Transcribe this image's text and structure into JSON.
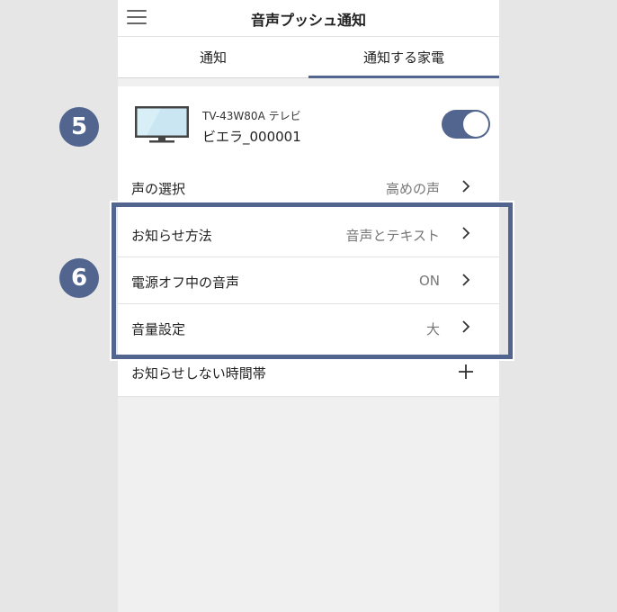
{
  "header": {
    "title": "音声プッシュ通知",
    "menu_icon": "hamburger-menu-icon"
  },
  "tabs": [
    {
      "label": "通知",
      "active": false
    },
    {
      "label": "通知する家電",
      "active": true
    }
  ],
  "device": {
    "model": "TV-43W80A テレビ",
    "name": "ビエラ_000001",
    "icon": "tv-icon",
    "enabled": true
  },
  "settings": [
    {
      "label": "声の選択",
      "value": "高めの声"
    },
    {
      "label": "お知らせ方法",
      "value": "音声とテキスト"
    },
    {
      "label": "電源オフ中の音声",
      "value": "ON"
    },
    {
      "label": "音量設定",
      "value": "大"
    }
  ],
  "quiet_hours": {
    "label": "お知らせしない時間帯",
    "icon": "plus-icon"
  },
  "annotations": {
    "badge_5": "5",
    "badge_6": "6"
  },
  "colors": {
    "accent": "#51658f",
    "background": "#e6e6e6",
    "panel": "#f0f0f0"
  }
}
